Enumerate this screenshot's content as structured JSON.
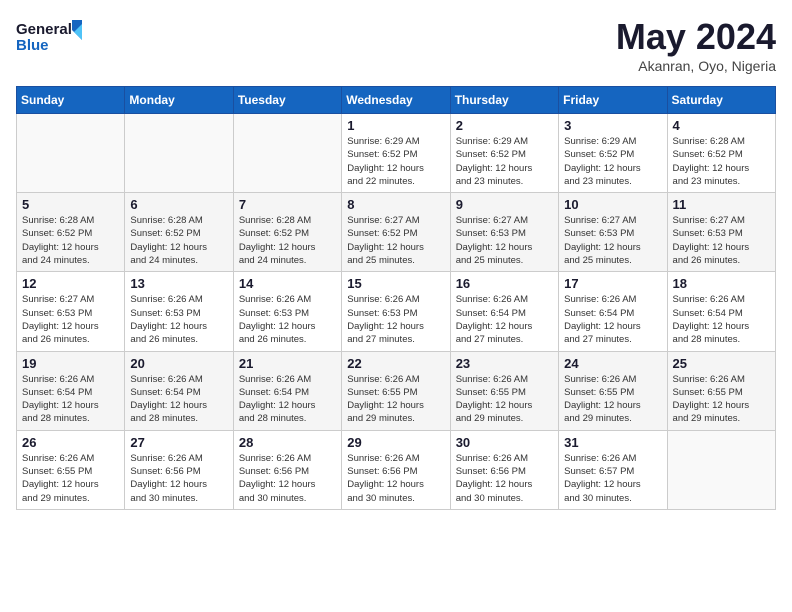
{
  "header": {
    "logo_line1": "General",
    "logo_line2": "Blue",
    "title": "May 2024",
    "subtitle": "Akanran, Oyo, Nigeria"
  },
  "weekdays": [
    "Sunday",
    "Monday",
    "Tuesday",
    "Wednesday",
    "Thursday",
    "Friday",
    "Saturday"
  ],
  "weeks": [
    [
      {
        "day": "",
        "info": ""
      },
      {
        "day": "",
        "info": ""
      },
      {
        "day": "",
        "info": ""
      },
      {
        "day": "1",
        "info": "Sunrise: 6:29 AM\nSunset: 6:52 PM\nDaylight: 12 hours\nand 22 minutes."
      },
      {
        "day": "2",
        "info": "Sunrise: 6:29 AM\nSunset: 6:52 PM\nDaylight: 12 hours\nand 23 minutes."
      },
      {
        "day": "3",
        "info": "Sunrise: 6:29 AM\nSunset: 6:52 PM\nDaylight: 12 hours\nand 23 minutes."
      },
      {
        "day": "4",
        "info": "Sunrise: 6:28 AM\nSunset: 6:52 PM\nDaylight: 12 hours\nand 23 minutes."
      }
    ],
    [
      {
        "day": "5",
        "info": "Sunrise: 6:28 AM\nSunset: 6:52 PM\nDaylight: 12 hours\nand 24 minutes."
      },
      {
        "day": "6",
        "info": "Sunrise: 6:28 AM\nSunset: 6:52 PM\nDaylight: 12 hours\nand 24 minutes."
      },
      {
        "day": "7",
        "info": "Sunrise: 6:28 AM\nSunset: 6:52 PM\nDaylight: 12 hours\nand 24 minutes."
      },
      {
        "day": "8",
        "info": "Sunrise: 6:27 AM\nSunset: 6:52 PM\nDaylight: 12 hours\nand 25 minutes."
      },
      {
        "day": "9",
        "info": "Sunrise: 6:27 AM\nSunset: 6:53 PM\nDaylight: 12 hours\nand 25 minutes."
      },
      {
        "day": "10",
        "info": "Sunrise: 6:27 AM\nSunset: 6:53 PM\nDaylight: 12 hours\nand 25 minutes."
      },
      {
        "day": "11",
        "info": "Sunrise: 6:27 AM\nSunset: 6:53 PM\nDaylight: 12 hours\nand 26 minutes."
      }
    ],
    [
      {
        "day": "12",
        "info": "Sunrise: 6:27 AM\nSunset: 6:53 PM\nDaylight: 12 hours\nand 26 minutes."
      },
      {
        "day": "13",
        "info": "Sunrise: 6:26 AM\nSunset: 6:53 PM\nDaylight: 12 hours\nand 26 minutes."
      },
      {
        "day": "14",
        "info": "Sunrise: 6:26 AM\nSunset: 6:53 PM\nDaylight: 12 hours\nand 26 minutes."
      },
      {
        "day": "15",
        "info": "Sunrise: 6:26 AM\nSunset: 6:53 PM\nDaylight: 12 hours\nand 27 minutes."
      },
      {
        "day": "16",
        "info": "Sunrise: 6:26 AM\nSunset: 6:54 PM\nDaylight: 12 hours\nand 27 minutes."
      },
      {
        "day": "17",
        "info": "Sunrise: 6:26 AM\nSunset: 6:54 PM\nDaylight: 12 hours\nand 27 minutes."
      },
      {
        "day": "18",
        "info": "Sunrise: 6:26 AM\nSunset: 6:54 PM\nDaylight: 12 hours\nand 28 minutes."
      }
    ],
    [
      {
        "day": "19",
        "info": "Sunrise: 6:26 AM\nSunset: 6:54 PM\nDaylight: 12 hours\nand 28 minutes."
      },
      {
        "day": "20",
        "info": "Sunrise: 6:26 AM\nSunset: 6:54 PM\nDaylight: 12 hours\nand 28 minutes."
      },
      {
        "day": "21",
        "info": "Sunrise: 6:26 AM\nSunset: 6:54 PM\nDaylight: 12 hours\nand 28 minutes."
      },
      {
        "day": "22",
        "info": "Sunrise: 6:26 AM\nSunset: 6:55 PM\nDaylight: 12 hours\nand 29 minutes."
      },
      {
        "day": "23",
        "info": "Sunrise: 6:26 AM\nSunset: 6:55 PM\nDaylight: 12 hours\nand 29 minutes."
      },
      {
        "day": "24",
        "info": "Sunrise: 6:26 AM\nSunset: 6:55 PM\nDaylight: 12 hours\nand 29 minutes."
      },
      {
        "day": "25",
        "info": "Sunrise: 6:26 AM\nSunset: 6:55 PM\nDaylight: 12 hours\nand 29 minutes."
      }
    ],
    [
      {
        "day": "26",
        "info": "Sunrise: 6:26 AM\nSunset: 6:55 PM\nDaylight: 12 hours\nand 29 minutes."
      },
      {
        "day": "27",
        "info": "Sunrise: 6:26 AM\nSunset: 6:56 PM\nDaylight: 12 hours\nand 30 minutes."
      },
      {
        "day": "28",
        "info": "Sunrise: 6:26 AM\nSunset: 6:56 PM\nDaylight: 12 hours\nand 30 minutes."
      },
      {
        "day": "29",
        "info": "Sunrise: 6:26 AM\nSunset: 6:56 PM\nDaylight: 12 hours\nand 30 minutes."
      },
      {
        "day": "30",
        "info": "Sunrise: 6:26 AM\nSunset: 6:56 PM\nDaylight: 12 hours\nand 30 minutes."
      },
      {
        "day": "31",
        "info": "Sunrise: 6:26 AM\nSunset: 6:57 PM\nDaylight: 12 hours\nand 30 minutes."
      },
      {
        "day": "",
        "info": ""
      }
    ]
  ]
}
